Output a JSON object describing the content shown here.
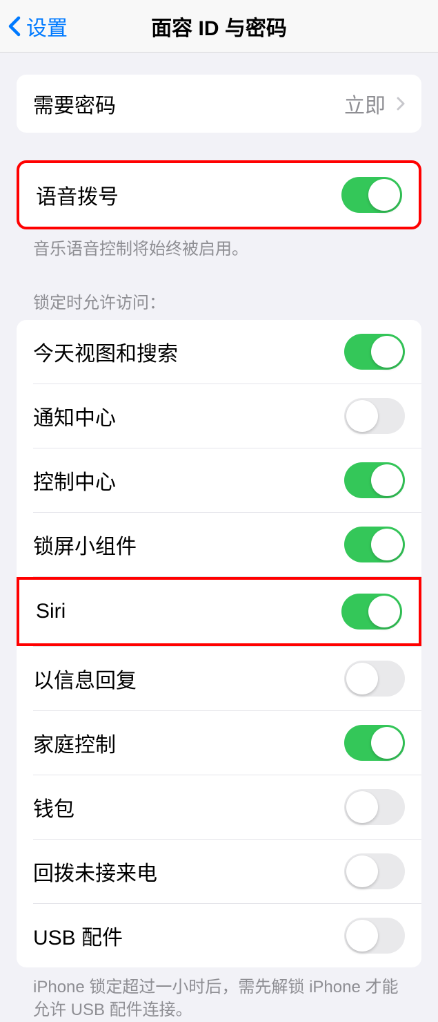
{
  "header": {
    "back_label": "设置",
    "title": "面容 ID 与密码"
  },
  "require_passcode": {
    "label": "需要密码",
    "value": "立即"
  },
  "voice_dial": {
    "label": "语音拨号",
    "on": true,
    "footer": "音乐语音控制将始终被启用。"
  },
  "lock_section": {
    "header": "锁定时允许访问：",
    "items": [
      {
        "label": "今天视图和搜索",
        "on": true
      },
      {
        "label": "通知中心",
        "on": false
      },
      {
        "label": "控制中心",
        "on": true
      },
      {
        "label": "锁屏小组件",
        "on": true
      },
      {
        "label": "Siri",
        "on": true
      },
      {
        "label": "以信息回复",
        "on": false
      },
      {
        "label": "家庭控制",
        "on": true
      },
      {
        "label": "钱包",
        "on": false
      },
      {
        "label": "回拨未接来电",
        "on": false
      },
      {
        "label": "USB 配件",
        "on": false
      }
    ],
    "footer": "iPhone 锁定超过一小时后，需先解锁 iPhone 才能允许 USB 配件连接。"
  }
}
